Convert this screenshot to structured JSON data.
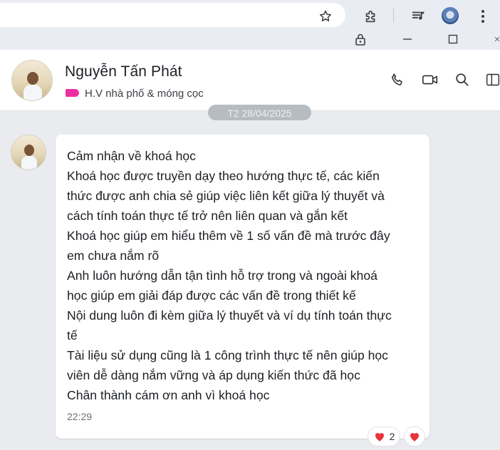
{
  "browser": {
    "icons": [
      "star-icon",
      "extension-icon",
      "media-control-icon",
      "profile-avatar-icon",
      "more-menu-icon",
      "lock-icon",
      "minimize-icon",
      "maximize-icon",
      "close-icon"
    ]
  },
  "header": {
    "contact_name": "Nguyễn Tấn Phát",
    "tag_label": "H.V nhà phố & móng cọc",
    "tag_color": "#ee2fa3",
    "actions": [
      "phone-icon",
      "video-call-icon",
      "search-icon",
      "sidebar-toggle-icon"
    ]
  },
  "chat": {
    "date_separator": "T2 28/04/2025",
    "message": {
      "lines": [
        "Cảm nhận về khoá học",
        "Khoá học được truyền dạy theo hướng thực tế, các kiến",
        "thức được anh chia sẻ giúp việc liên kết giữa lý thuyết và",
        "cách tính toán thực tế trở nên liên quan và gắn kết",
        "Khoá học giúp em hiểu thêm về 1 số vấn đề mà trước đây",
        "em chưa nắm rõ",
        "Anh luôn hướng dẫn tận tình hỗ trợ trong và ngoài khoá",
        "học giúp em giải đáp được các vấn đề trong thiết kế",
        "Nội dung luôn đi kèm giữa lý thuyết và ví dụ tính toán thực",
        "tế",
        "Tài liệu sử dụng cũng là 1 công trình thực tế nên giúp học",
        "viên dễ dàng nắm vững và áp dụng kiến thức đã học",
        "Chân thành cám ơn anh vì khoá học"
      ],
      "time": "22:29"
    },
    "reactions": {
      "heart_count": "2",
      "heart_color": "#e8323c"
    }
  }
}
